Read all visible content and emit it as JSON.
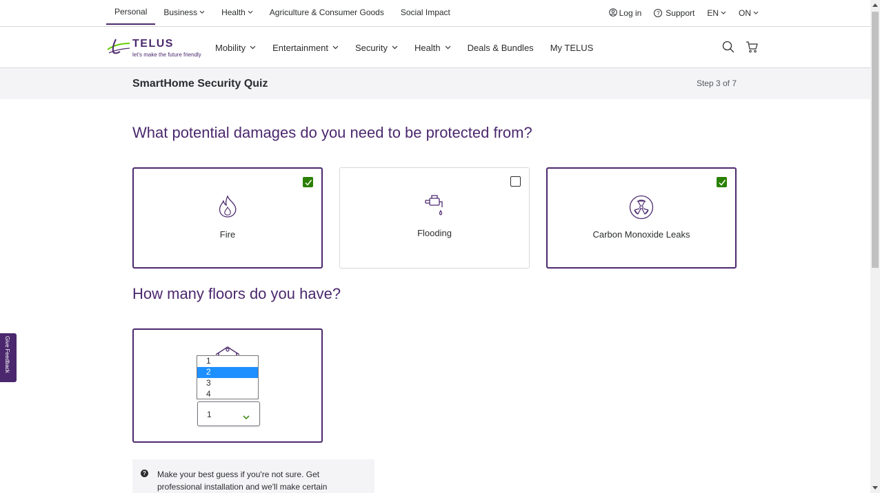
{
  "utility_nav": {
    "left": [
      {
        "label": "Personal",
        "active": true,
        "dropdown": false
      },
      {
        "label": "Business",
        "active": false,
        "dropdown": true
      },
      {
        "label": "Health",
        "active": false,
        "dropdown": true
      },
      {
        "label": "Agriculture & Consumer Goods",
        "active": false,
        "dropdown": false
      },
      {
        "label": "Social Impact",
        "active": false,
        "dropdown": false
      }
    ],
    "right": {
      "login": "Log in",
      "support": "Support",
      "language": "EN",
      "province": "ON"
    }
  },
  "brand": {
    "name": "TELUS",
    "tagline": "let's make the future friendly",
    "color": "#4b286d",
    "accent": "#66cc00"
  },
  "main_nav": {
    "items": [
      {
        "label": "Mobility",
        "dropdown": true
      },
      {
        "label": "Entertainment",
        "dropdown": true
      },
      {
        "label": "Security",
        "dropdown": true
      },
      {
        "label": "Health",
        "dropdown": true
      },
      {
        "label": "Deals & Bundles",
        "dropdown": false
      },
      {
        "label": "My TELUS",
        "dropdown": false
      }
    ],
    "icons": [
      "search-icon",
      "cart-icon"
    ]
  },
  "quiz": {
    "title": "SmartHome Security Quiz",
    "step": "Step 3 of 7"
  },
  "question1": {
    "heading": "What potential damages do you need to be protected from?",
    "options": [
      {
        "label": "Fire",
        "icon": "fire-icon",
        "checked": true
      },
      {
        "label": "Flooding",
        "icon": "faucet-icon",
        "checked": false
      },
      {
        "label": "Carbon Monoxide Leaks",
        "icon": "radiation-icon",
        "checked": true
      }
    ]
  },
  "question2": {
    "heading": "How many floors do you have?",
    "select_value": "1",
    "dropdown_options": [
      "1",
      "2",
      "3",
      "4"
    ],
    "highlighted_option": "2"
  },
  "tip": {
    "icon": "question-icon",
    "text": "Make your best guess if you're not sure. Get professional installation and we'll make certain"
  },
  "feedback": {
    "label": "Give Feedback"
  },
  "colors": {
    "checked_green": "#2b8000",
    "highlight_blue": "#1e90ff",
    "panel_grey": "#f4f4f7"
  }
}
